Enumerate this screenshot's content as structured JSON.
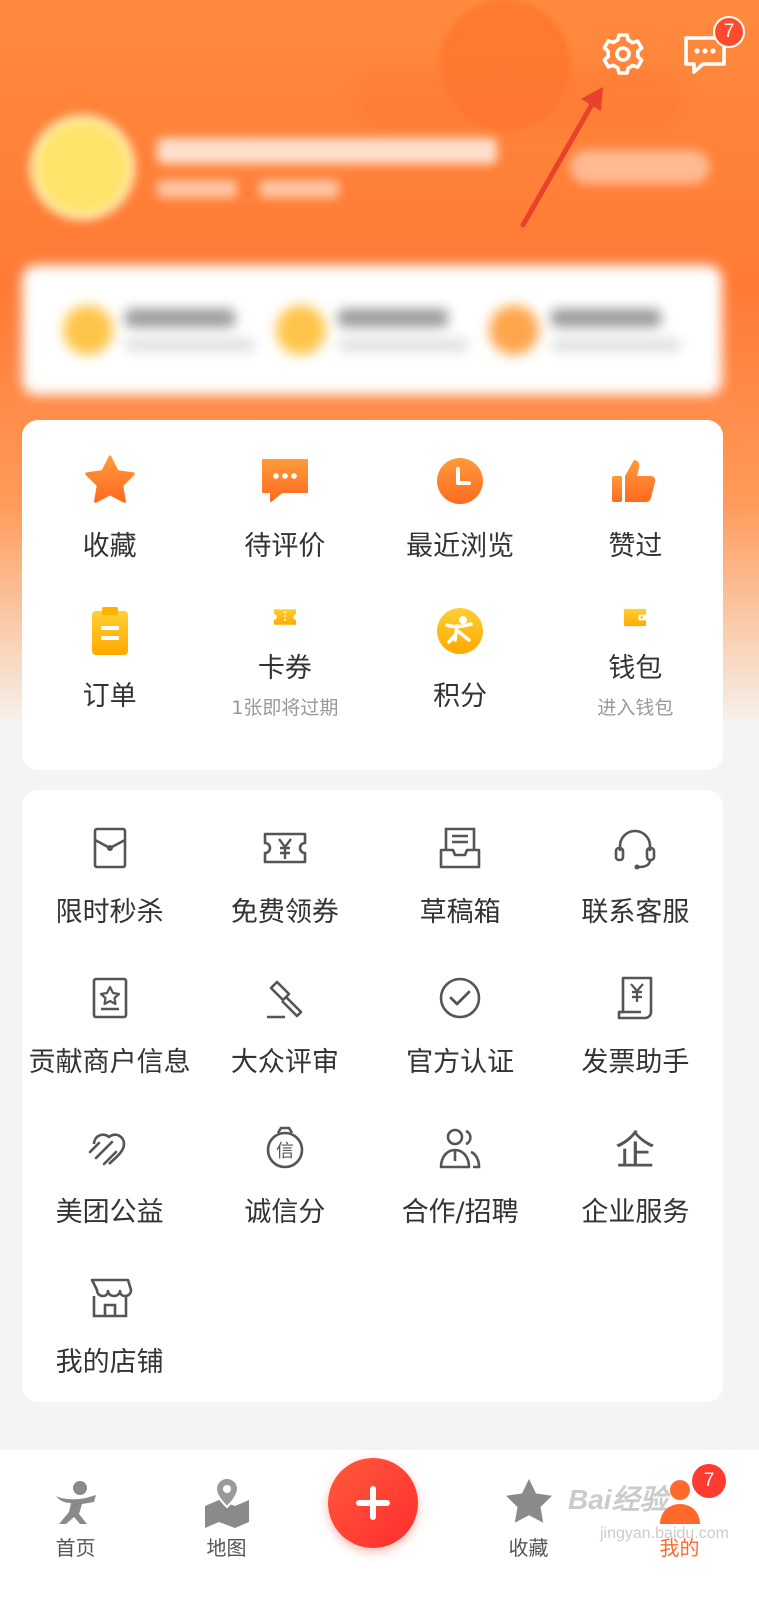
{
  "header": {
    "settings_icon": "gear-icon",
    "message_icon": "chat-bubble-icon",
    "message_badge": "7"
  },
  "colors": {
    "brand_orange": "#ff7a35",
    "icon_orange": "#ff8a2a",
    "icon_yellow": "#ffb300",
    "badge_red": "#ff3b30",
    "fab_red": "#ff3b30"
  },
  "primary_grid": [
    {
      "label": "收藏",
      "sub": "",
      "icon": "star-icon"
    },
    {
      "label": "待评价",
      "sub": "",
      "icon": "comment-icon"
    },
    {
      "label": "最近浏览",
      "sub": "",
      "icon": "clock-icon"
    },
    {
      "label": "赞过",
      "sub": "",
      "icon": "thumbs-up-icon"
    },
    {
      "label": "订单",
      "sub": "",
      "icon": "clipboard-icon"
    },
    {
      "label": "卡券",
      "sub": "1张即将过期",
      "icon": "ticket-icon"
    },
    {
      "label": "积分",
      "sub": "",
      "icon": "points-icon"
    },
    {
      "label": "钱包",
      "sub": "进入钱包",
      "icon": "wallet-icon"
    }
  ],
  "services_grid": [
    {
      "label": "限时秒杀",
      "icon": "red-packet-icon"
    },
    {
      "label": "免费领券",
      "icon": "coupon-yen-icon"
    },
    {
      "label": "草稿箱",
      "icon": "drafts-icon"
    },
    {
      "label": "联系客服",
      "icon": "headset-icon"
    },
    {
      "label": "贡献商户信息",
      "icon": "merchant-star-icon"
    },
    {
      "label": "大众评审",
      "icon": "gavel-icon"
    },
    {
      "label": "官方认证",
      "icon": "check-circle-icon"
    },
    {
      "label": "发票助手",
      "icon": "invoice-icon"
    },
    {
      "label": "美团公益",
      "icon": "charity-heart-icon"
    },
    {
      "label": "诚信分",
      "icon": "credit-badge-icon"
    },
    {
      "label": "合作/招聘",
      "icon": "people-icon"
    },
    {
      "label": "企业服务",
      "icon": "enterprise-icon"
    },
    {
      "label": "我的店铺",
      "icon": "storefront-icon"
    }
  ],
  "services_grid_glyphs": {
    "credit": "信",
    "enterprise": "企"
  },
  "tabbar": {
    "home": "首页",
    "map": "地图",
    "add": "add-icon",
    "favorites": "收藏",
    "mine": "我的",
    "mine_badge": "7"
  },
  "watermark": {
    "text": "Bai经验",
    "sub": "jingyan.baidu.com"
  }
}
